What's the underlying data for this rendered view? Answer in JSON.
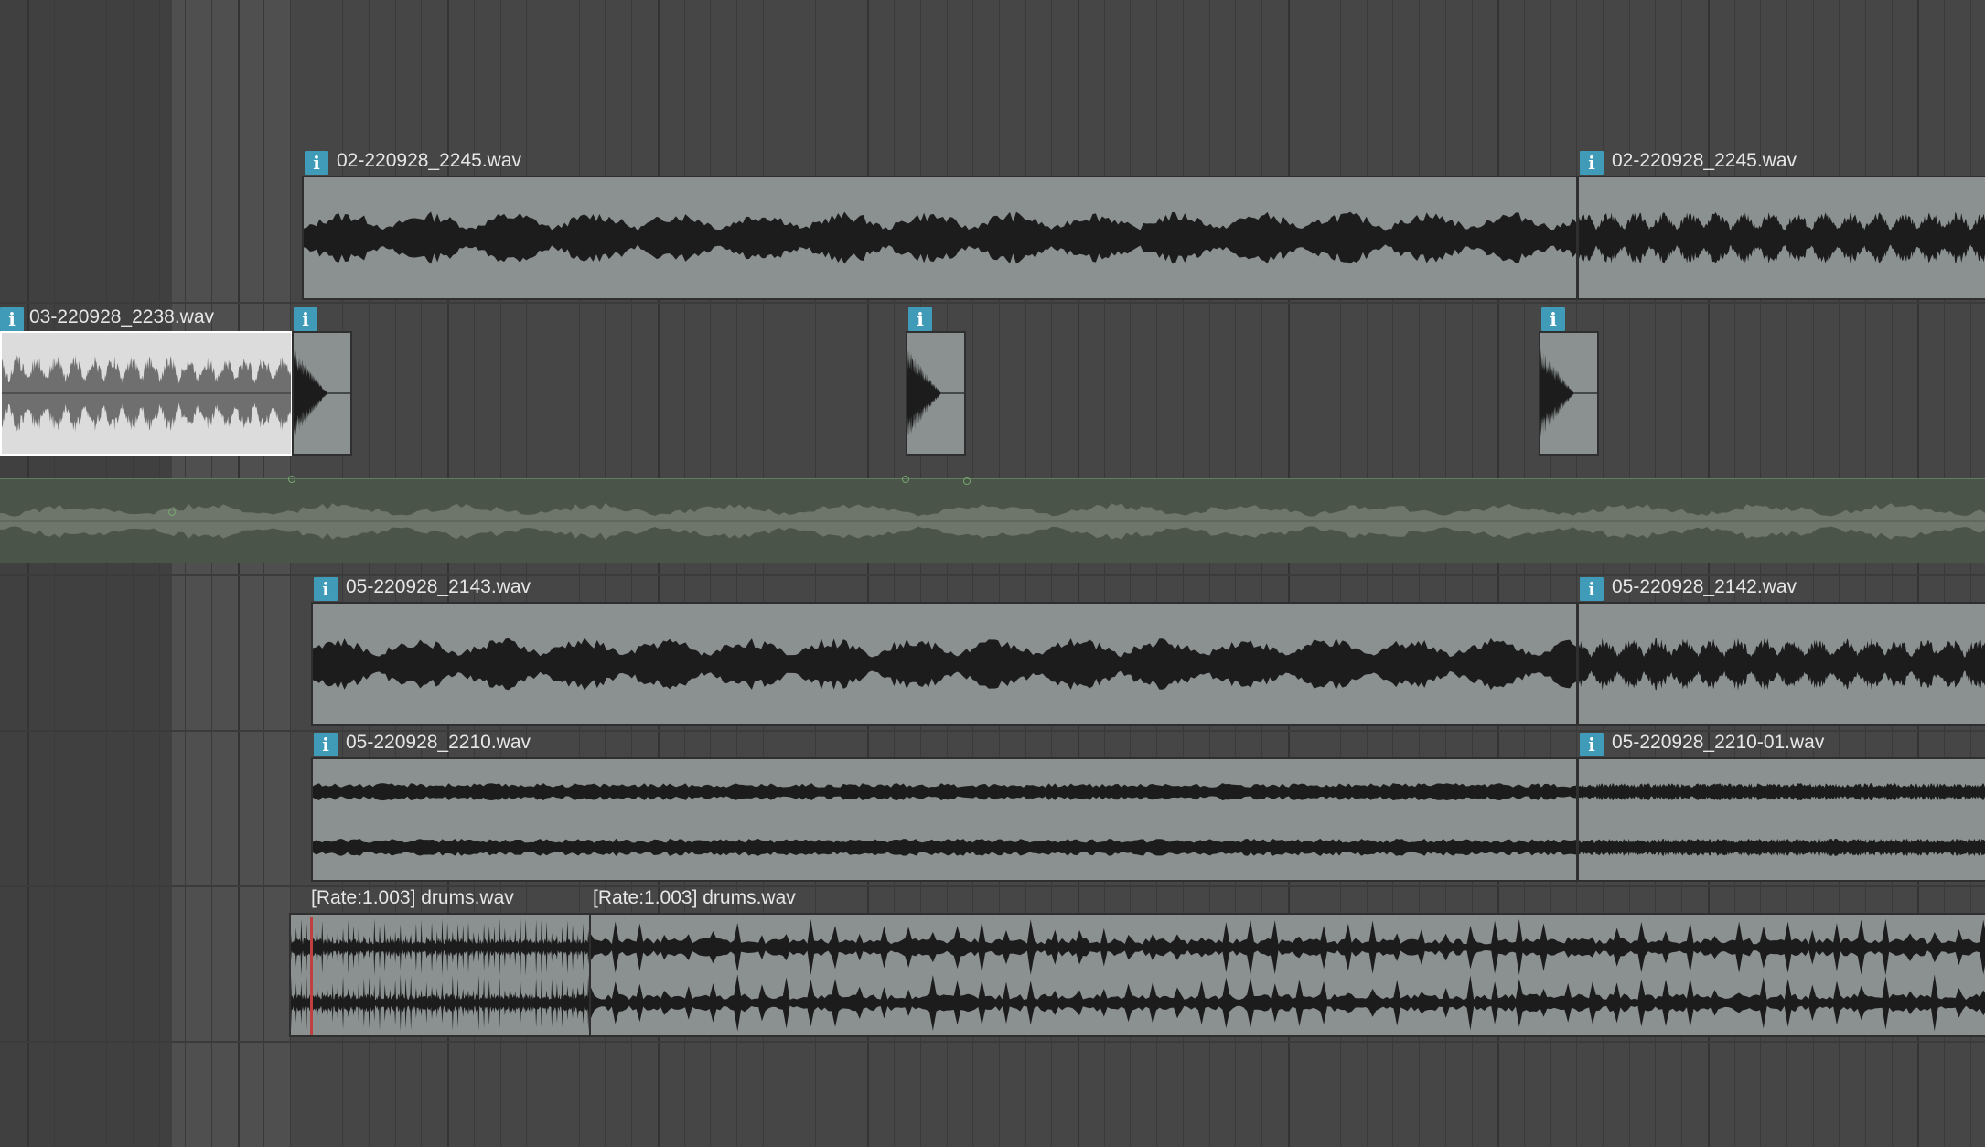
{
  "tracks": [
    {
      "items": [
        {
          "label": "02-220928_2245.wav",
          "info_icon": "info-icon"
        },
        {
          "label": "02-220928_2245.wav",
          "info_icon": "info-icon"
        }
      ]
    },
    {
      "items": [
        {
          "label": "03-220928_2238.wav",
          "info_icon": "info-icon",
          "selected": true
        },
        {
          "label": "",
          "info_icon": "info-icon"
        },
        {
          "label": "",
          "info_icon": "info-icon"
        },
        {
          "label": "",
          "info_icon": "info-icon"
        }
      ],
      "envelope": "volume-envelope"
    },
    {
      "items": [
        {
          "label": "05-220928_2143.wav",
          "info_icon": "info-icon"
        },
        {
          "label": "05-220928_2142.wav",
          "info_icon": "info-icon"
        }
      ]
    },
    {
      "items": [
        {
          "label": "05-220928_2210.wav",
          "info_icon": "info-icon"
        },
        {
          "label": "05-220928_2210-01.wav",
          "info_icon": "info-icon"
        }
      ]
    },
    {
      "items": [
        {
          "label": "[Rate:1.003] drums.wav"
        },
        {
          "label": "[Rate:1.003] drums.wav"
        }
      ]
    }
  ],
  "info_glyph": "i",
  "colors": {
    "background": "#464646",
    "item_fill": "#8a9190",
    "item_selected": "#dcdcdc",
    "waveform": "#1c1c1c",
    "info_icon": "#3f9bb8",
    "envelope_lane": "#4a5448",
    "playhead": "#c04040"
  }
}
